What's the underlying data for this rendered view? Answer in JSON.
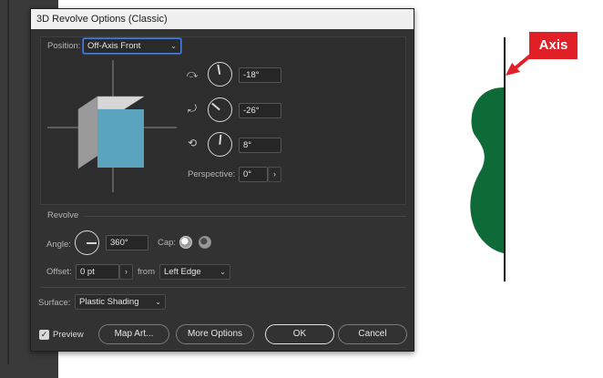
{
  "dialog": {
    "title": "3D Revolve Options (Classic)",
    "position": {
      "label": "Position:",
      "value": "Off-Axis Front"
    },
    "rotation": {
      "x_value": "-18°",
      "y_value": "-26°",
      "z_value": "8°",
      "perspective_label": "Perspective:",
      "perspective_value": "0°"
    },
    "revolve": {
      "section_label": "Revolve",
      "angle_label": "Angle:",
      "angle_value": "360°",
      "cap_label": "Cap:",
      "offset_label": "Offset:",
      "offset_value": "0 pt",
      "from_label": "from",
      "from_value": "Left Edge"
    },
    "surface": {
      "label": "Surface:",
      "value": "Plastic Shading"
    },
    "footer": {
      "preview_label": "Preview",
      "preview_checked": true,
      "map_art_label": "Map Art...",
      "more_options_label": "More Options",
      "ok_label": "OK",
      "cancel_label": "Cancel"
    }
  },
  "illustration": {
    "axis_label": "Axis",
    "shape_color": "#0e6b37",
    "tag_color": "#e01f26"
  },
  "colors": {
    "dialog_bg": "#323232",
    "cube_front": "#5aa4bf",
    "cube_side": "#9a9a9a",
    "cube_top": "#d7d7d7"
  }
}
